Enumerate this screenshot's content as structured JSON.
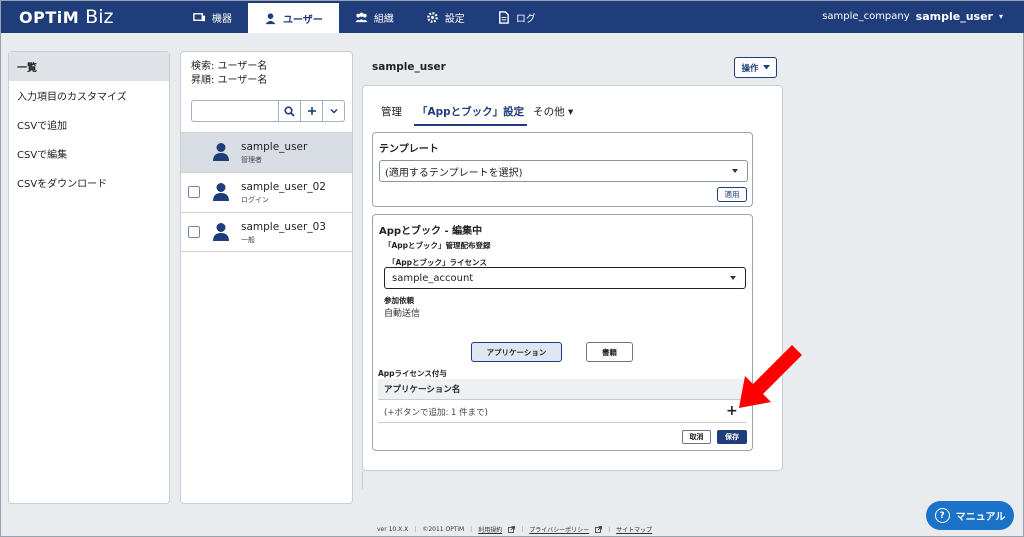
{
  "brand": {
    "logo": "OPTiM",
    "product": "Biz"
  },
  "nav": [
    {
      "label": "機器",
      "icon": "device-icon"
    },
    {
      "label": "ユーザー",
      "icon": "user-icon",
      "active": true
    },
    {
      "label": "組織",
      "icon": "group-icon"
    },
    {
      "label": "設定",
      "icon": "gear-icon"
    },
    {
      "label": "ログ",
      "icon": "log-icon"
    }
  ],
  "account": {
    "company": "sample_company",
    "user": "sample_user",
    "caret": "▾"
  },
  "left_menu": [
    {
      "label": "一覧",
      "active": true
    },
    {
      "label": "入力項目のカスタマイズ"
    },
    {
      "label": "CSVで追加"
    },
    {
      "label": "CSVで編集"
    },
    {
      "label": "CSVをダウンロード"
    }
  ],
  "user_list": {
    "search_field": "検索: ユーザー名",
    "sort_order": "昇順: ユーザー名",
    "search_placeholder": "",
    "users": [
      {
        "name": "sample_user",
        "role": "管理者",
        "selected": true
      },
      {
        "name": "sample_user_02",
        "role": "ログイン"
      },
      {
        "name": "sample_user_03",
        "role": "一般"
      }
    ]
  },
  "main": {
    "title": "sample_user",
    "operation_button": "操作",
    "tabs": [
      {
        "label": "管理"
      },
      {
        "label": "「Appとブック」設定",
        "active": true
      },
      {
        "label": "その他 ▾"
      }
    ],
    "template": {
      "title": "テンプレート",
      "select_value": "(適用するテンプレートを選択)",
      "apply_button": "適用"
    },
    "edit": {
      "title": "Appとブック - 編集中",
      "distribution_label": "「Appとブック」管理配布登録",
      "license_label": "「Appとブック」ライセンス",
      "license_value": "sample_account",
      "participation_label": "参加依頼",
      "participation_value": "自動送信",
      "app_button": "アプリケーション",
      "book_button": "書籍",
      "grant_label": "Appライセンス付与",
      "table_header": "アプリケーション名",
      "table_hint": "(+ボタンで追加: 1 件まで)",
      "add_symbol": "+",
      "cancel_button": "取消",
      "save_button": "保存"
    }
  },
  "footer": {
    "version": "ver 10.X.X",
    "copyright": "©2011 OPTiM",
    "terms": "利用規約",
    "privacy": "プライバシーポリシー",
    "sitemap": "サイトマップ"
  },
  "manual_button": "マニュアル",
  "colors": {
    "primary": "#1f3d7a",
    "annotation_arrow": "#ff0000",
    "manual": "#1a73c9"
  }
}
